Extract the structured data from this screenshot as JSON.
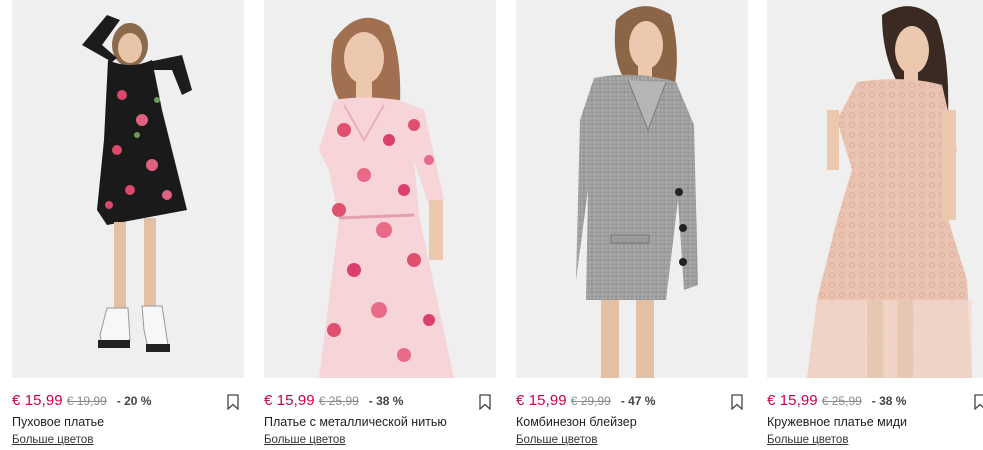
{
  "products": [
    {
      "price": "€ 15,99",
      "old_price": "€ 19,99",
      "discount": "- 20 %",
      "name": "Пуховое платье",
      "more_colors": "Больше цветов",
      "bookmark_icon": "bookmark-icon"
    },
    {
      "price": "€ 15,99",
      "old_price": "€ 25,99",
      "discount": "- 38 %",
      "name": "Платье с металлической нитью",
      "more_colors": "Больше цветов",
      "bookmark_icon": "bookmark-icon"
    },
    {
      "price": "€ 15,99",
      "old_price": "€ 29,99",
      "discount": "- 47 %",
      "name": "Комбинезон блейзер",
      "more_colors": "Больше цветов",
      "bookmark_icon": "bookmark-icon"
    },
    {
      "price": "€ 15,99",
      "old_price": "€ 25,99",
      "discount": "- 38 %",
      "name": "Кружевное платье миди",
      "more_colors": "Больше цветов",
      "bookmark_icon": "bookmark-icon"
    }
  ],
  "colors": {
    "price": "#c8004f",
    "photo_background": "#efefef"
  }
}
